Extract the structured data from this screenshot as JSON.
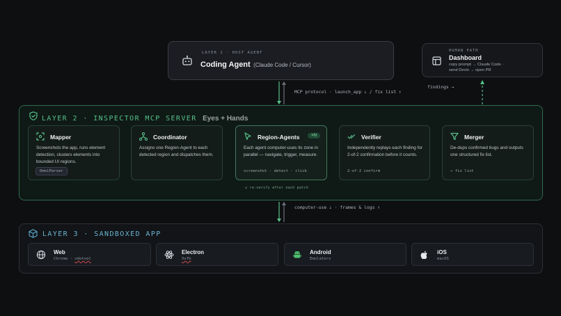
{
  "layer1": {
    "kicker": "LAYER 1 · HOST AGENT",
    "title": "Coding Agent",
    "subtitle": "(Claude Code / Cursor)",
    "icon": "robot-icon"
  },
  "human": {
    "kicker": "HUMAN PATH",
    "title": "Dashboard",
    "line1": "copy prompt → Claude Code ·",
    "line2": "send Devin → open PR",
    "icon": "layout-icon"
  },
  "connectors": {
    "mcp": "MCP protocol · launch_app ↓ / fix list ↑",
    "findings": "findings →",
    "reverify": "↺ re-verify after each patch",
    "computer_use": "computer-use ↓ · frames & logs ↑"
  },
  "layer2": {
    "title": "LAYER 2 · INSPECTOR MCP SERVER",
    "tagline": "Eyes + Hands",
    "icon": "shield-check-icon",
    "stages": [
      {
        "title": "Mapper",
        "desc": "Screenshots the app, runs element detection, clusters elements into bounded UI regions.",
        "chip": "OmniParser",
        "icon": "scan-icon"
      },
      {
        "title": "Coordinator",
        "desc": "Assigns one Region-Agent to each detected region and dispatches them.",
        "icon": "network-icon"
      },
      {
        "title": "Region-Agents",
        "badge": "×N",
        "desc": "Each agent computer-uses its zone in parallel — navigate, trigger, measure.",
        "foot": "screenshot · detect · click",
        "icon": "cursor-icon"
      },
      {
        "title": "Verifier",
        "desc": "Independently replays each finding for 2-of-2 confirmation before it counts.",
        "foot": "2-of-2 confirm",
        "icon": "double-check-icon"
      },
      {
        "title": "Merger",
        "desc": "De-dups confirmed bugs and outputs one structured fix list.",
        "foot": "→ fix list",
        "icon": "funnel-icon"
      }
    ]
  },
  "layer3": {
    "title": "LAYER 3 · SANDBOXED APP",
    "icon": "cube-icon",
    "targets": [
      {
        "name": "Web",
        "sub_a": "Chrome",
        "sep": " · ",
        "sub_b": "xdotool",
        "icon": "globe-icon"
      },
      {
        "name": "Electron",
        "sub_a": "",
        "sep": "",
        "sub_b": "Xvfb",
        "icon": "atom-icon"
      },
      {
        "name": "Android",
        "sub_a": "Emulators",
        "sep": "",
        "sub_b": "",
        "icon": "android-icon"
      },
      {
        "name": "iOS",
        "sub_a": "macOS",
        "sep": "",
        "sub_b": "",
        "icon": "apple-icon"
      }
    ]
  },
  "colors": {
    "accent": "#57c08a",
    "accent_dim": "#2f6a4c",
    "bg": "#0e0f11"
  }
}
